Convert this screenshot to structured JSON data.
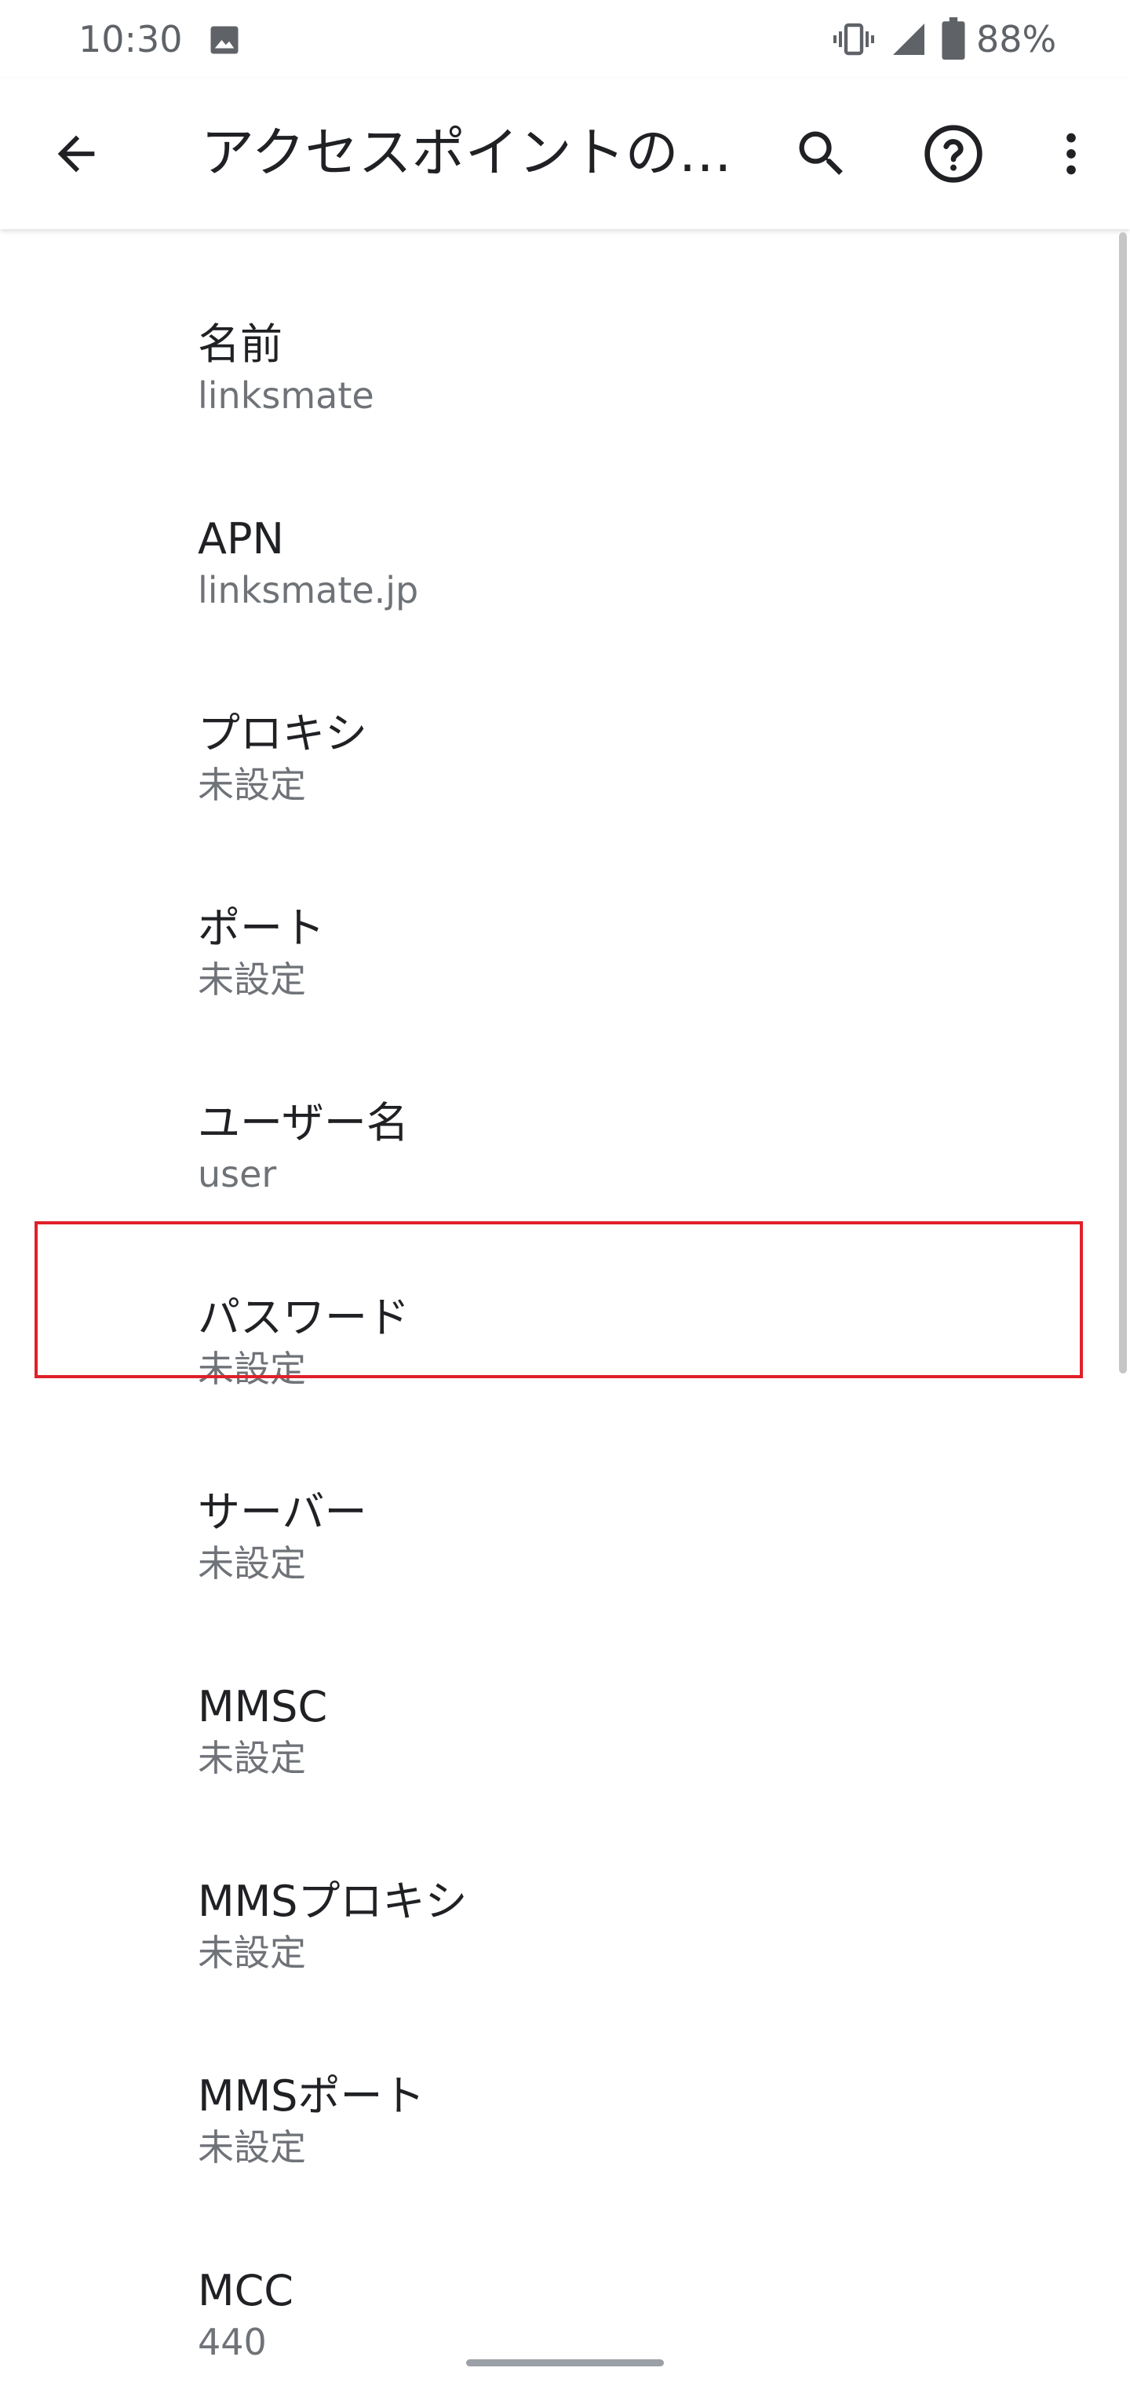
{
  "status_bar": {
    "time": "10:30",
    "battery_percent": "88%",
    "icons": [
      "gallery-icon",
      "vibrate-icon",
      "signal-icon",
      "battery-icon"
    ]
  },
  "app_bar": {
    "title": "アクセスポイントの…",
    "icons": [
      "back-arrow-icon",
      "search-icon",
      "help-icon",
      "more-vert-icon"
    ]
  },
  "items": [
    {
      "title": "名前",
      "summary": "linksmate"
    },
    {
      "title": "APN",
      "summary": "linksmate.jp"
    },
    {
      "title": "プロキシ",
      "summary": "未設定"
    },
    {
      "title": "ポート",
      "summary": "未設定"
    },
    {
      "title": "ユーザー名",
      "summary": "user"
    },
    {
      "title": "パスワード",
      "summary": "未設定"
    },
    {
      "title": "サーバー",
      "summary": "未設定"
    },
    {
      "title": "MMSC",
      "summary": "未設定"
    },
    {
      "title": "MMSプロキシ",
      "summary": "未設定"
    },
    {
      "title": "MMSポート",
      "summary": "未設定"
    },
    {
      "title": "MCC",
      "summary": "440"
    }
  ],
  "colors": {
    "highlight": "#e0202a",
    "primary_text": "#202124",
    "secondary_text": "#6f7378"
  }
}
